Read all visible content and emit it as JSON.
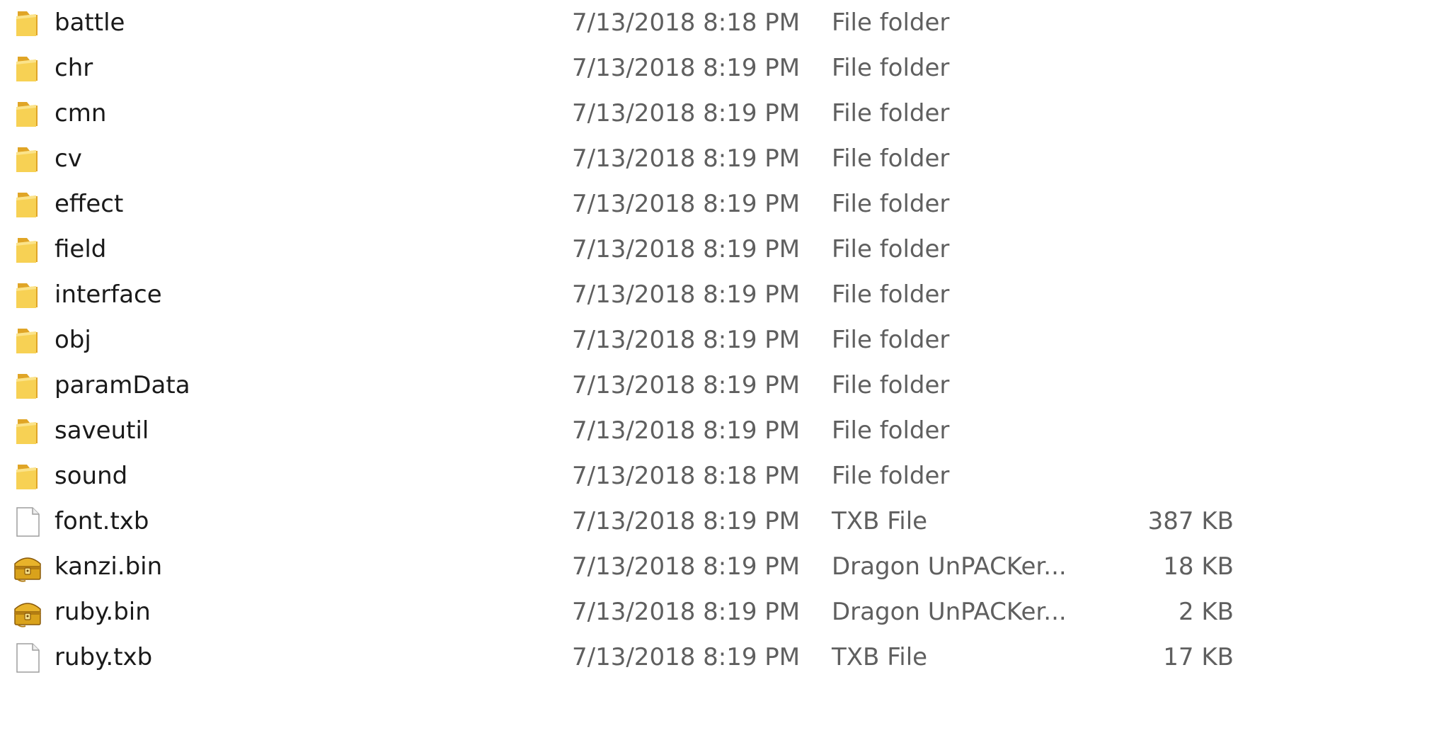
{
  "files": [
    {
      "name": "battle",
      "date": "7/13/2018 8:18 PM",
      "type": "File folder",
      "size": "",
      "icon": "folder-icon"
    },
    {
      "name": "chr",
      "date": "7/13/2018 8:19 PM",
      "type": "File folder",
      "size": "",
      "icon": "folder-icon"
    },
    {
      "name": "cmn",
      "date": "7/13/2018 8:19 PM",
      "type": "File folder",
      "size": "",
      "icon": "folder-icon"
    },
    {
      "name": "cv",
      "date": "7/13/2018 8:19 PM",
      "type": "File folder",
      "size": "",
      "icon": "folder-icon"
    },
    {
      "name": "effect",
      "date": "7/13/2018 8:19 PM",
      "type": "File folder",
      "size": "",
      "icon": "folder-icon"
    },
    {
      "name": "field",
      "date": "7/13/2018 8:19 PM",
      "type": "File folder",
      "size": "",
      "icon": "folder-icon"
    },
    {
      "name": "interface",
      "date": "7/13/2018 8:19 PM",
      "type": "File folder",
      "size": "",
      "icon": "folder-icon"
    },
    {
      "name": "obj",
      "date": "7/13/2018 8:19 PM",
      "type": "File folder",
      "size": "",
      "icon": "folder-icon"
    },
    {
      "name": "paramData",
      "date": "7/13/2018 8:19 PM",
      "type": "File folder",
      "size": "",
      "icon": "folder-icon"
    },
    {
      "name": "saveutil",
      "date": "7/13/2018 8:19 PM",
      "type": "File folder",
      "size": "",
      "icon": "folder-icon"
    },
    {
      "name": "sound",
      "date": "7/13/2018 8:18 PM",
      "type": "File folder",
      "size": "",
      "icon": "folder-icon"
    },
    {
      "name": "font.txb",
      "date": "7/13/2018 8:19 PM",
      "type": "TXB File",
      "size": "387 KB",
      "icon": "blank-file-icon"
    },
    {
      "name": "kanzi.bin",
      "date": "7/13/2018 8:19 PM",
      "type": "Dragon UnPACKer...",
      "size": "18 KB",
      "icon": "treasure-chest-icon"
    },
    {
      "name": "ruby.bin",
      "date": "7/13/2018 8:19 PM",
      "type": "Dragon UnPACKer...",
      "size": "2 KB",
      "icon": "treasure-chest-icon"
    },
    {
      "name": "ruby.txb",
      "date": "7/13/2018 8:19 PM",
      "type": "TXB File",
      "size": "17 KB",
      "icon": "blank-file-icon"
    }
  ],
  "colors": {
    "folder": "#f5c842",
    "folder_dark": "#e0a526",
    "chest": "#d9a21b",
    "name_text": "#1a1a1a",
    "detail_text": "#5f5f5f"
  }
}
